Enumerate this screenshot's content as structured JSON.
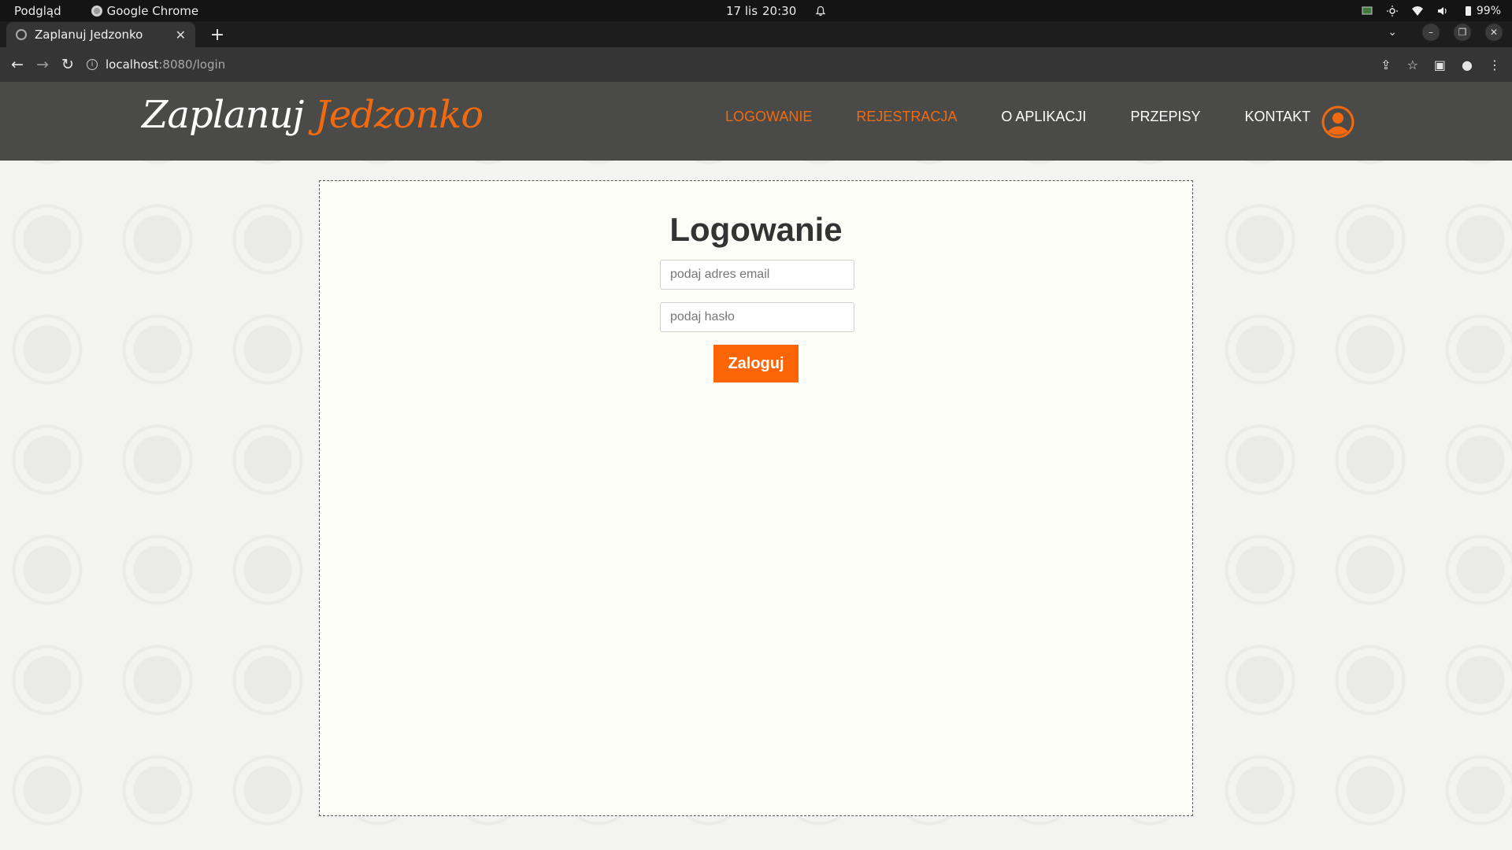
{
  "os_bar": {
    "app_menu": "Podgląd",
    "active_app": "Google Chrome",
    "date": "17 lis",
    "time": "20:30",
    "battery": "99%"
  },
  "browser": {
    "tab_title": "Zaplanuj Jedzonko",
    "url_host": "localhost",
    "url_path": ":8080/login"
  },
  "site": {
    "logo_part1": "Zaplanuj",
    "logo_part2": "Jedzonko",
    "nav": [
      {
        "label": "LOGOWANIE"
      },
      {
        "label": "REJESTRACJA"
      },
      {
        "label": "O APLIKACJI"
      },
      {
        "label": "PRZEPISY"
      },
      {
        "label": "KONTAKT"
      }
    ],
    "accent_color": "#f26a0f"
  },
  "login": {
    "title": "Logowanie",
    "email_placeholder": "podaj adres email",
    "password_placeholder": "podaj hasło",
    "submit_label": "Zaloguj"
  }
}
